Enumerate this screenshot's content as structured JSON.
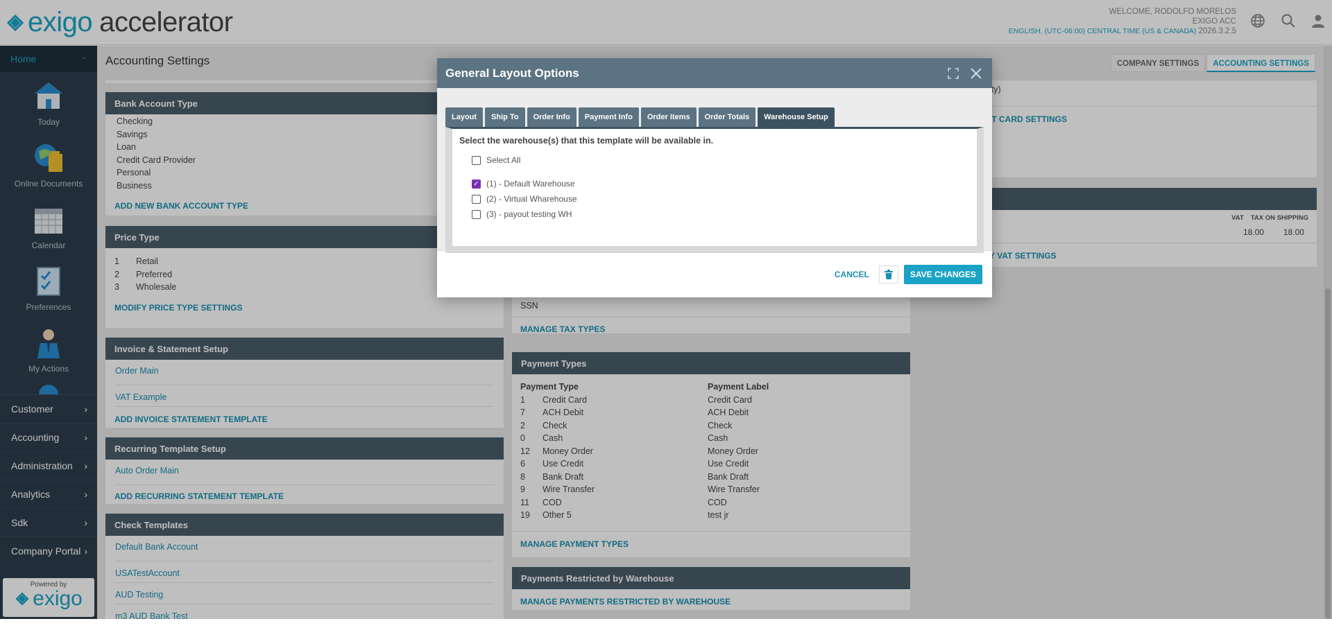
{
  "header": {
    "logo_word1": "exigo",
    "logo_word2": "accelerator",
    "welcome": "WELCOME, RODOLFO MORELOS",
    "company": "EXIGO ACC",
    "timezone": "ENGLISH, (UTC-06:00) CENTRAL TIME (US & CANADA)",
    "version": "2026.3.2.5",
    "icons": [
      "globe-icon",
      "search-icon",
      "user-icon"
    ]
  },
  "sidebar": {
    "home": "Home",
    "tiles": [
      {
        "label": "Today",
        "icon": "house-icon"
      },
      {
        "label": "Online Documents",
        "icon": "globe-folder-icon"
      },
      {
        "label": "Calendar",
        "icon": "calendar-icon"
      },
      {
        "label": "Preferences",
        "icon": "checklist-icon"
      },
      {
        "label": "My Actions",
        "icon": "person-icon"
      }
    ],
    "nav": [
      "Customer",
      "Accounting",
      "Administration",
      "Analytics",
      "Sdk",
      "Company Portal"
    ],
    "powered_by": "Powered by",
    "powered_logo": "exigo"
  },
  "page": {
    "title": "Accounting Settings",
    "tabs": [
      "COMPANY SETTINGS",
      "ACCOUNTING SETTINGS"
    ]
  },
  "bank_account_type": {
    "title": "Bank Account Type",
    "items": [
      "Checking",
      "Savings",
      "Loan",
      "Credit Card Provider",
      "Personal",
      "Business"
    ],
    "action": "ADD NEW BANK ACCOUNT TYPE"
  },
  "price_type": {
    "title": "Price Type",
    "items": [
      {
        "id": "1",
        "name": "Retail"
      },
      {
        "id": "2",
        "name": "Preferred"
      },
      {
        "id": "3",
        "name": "Wholesale"
      }
    ],
    "action": "MODIFY PRICE TYPE SETTINGS"
  },
  "invoice_setup": {
    "title": "Invoice & Statement Setup",
    "items": [
      "Order Main",
      "VAT Example"
    ],
    "action": "ADD INVOICE STATEMENT TEMPLATE"
  },
  "recurring_setup": {
    "title": "Recurring Template Setup",
    "items": [
      "Auto Order Main"
    ],
    "action": "ADD RECURRING STATEMENT TEMPLATE"
  },
  "check_templates": {
    "title": "Check Templates",
    "items": [
      "Default Bank Account",
      "USATestAccount",
      "AUD Testing",
      "m3 AUD Bank Test"
    ]
  },
  "tax_types": {
    "last_item": "SSN",
    "action": "MANAGE TAX TYPES"
  },
  "payment_types": {
    "title": "Payment Types",
    "col_type": "Payment Type",
    "col_label": "Payment Label",
    "rows": [
      {
        "id": "1",
        "type": "Credit Card",
        "label": "Credit Card"
      },
      {
        "id": "7",
        "type": "ACH Debit",
        "label": "ACH Debit"
      },
      {
        "id": "2",
        "type": "Check",
        "label": "Check"
      },
      {
        "id": "0",
        "type": "Cash",
        "label": "Cash"
      },
      {
        "id": "12",
        "type": "Money Order",
        "label": "Money Order"
      },
      {
        "id": "6",
        "type": "Use Credit",
        "label": "Use Credit"
      },
      {
        "id": "8",
        "type": "Bank Draft",
        "label": "Bank Draft"
      },
      {
        "id": "9",
        "type": "Wire Transfer",
        "label": "Wire Transfer"
      },
      {
        "id": "11",
        "type": "COD",
        "label": "COD"
      },
      {
        "id": "19",
        "type": "Other 5",
        "label": "test jr"
      }
    ],
    "action": "MANAGE PAYMENT TYPES"
  },
  "payments_restricted": {
    "title": "Payments Restricted by Warehouse",
    "action": "MANAGE PAYMENTS RESTRICTED BY WAREHOUSE"
  },
  "right_col": {
    "partial_text": "ity)",
    "card_link": "IT CARD SETTINGS",
    "vat_header": "VAT",
    "tax_ship_header": "TAX ON SHIPPING",
    "vat_value": "18.00",
    "tax_ship_value": "18.00",
    "vat_link": "Y VAT SETTINGS"
  },
  "modal": {
    "title": "General Layout Options",
    "tabs": [
      "Layout",
      "Ship To",
      "Order Info",
      "Payment Info",
      "Order Items",
      "Order Totals",
      "Warehouse Setup"
    ],
    "active_tab": "Warehouse Setup",
    "question": "Select the warehouse(s) that this template will be available in.",
    "select_all": "Select All",
    "warehouses": [
      {
        "label": "(1) - Default Warehouse",
        "checked": true
      },
      {
        "label": "(2) - Virtual Wharehouse",
        "checked": false
      },
      {
        "label": "(3) - payout testing WH",
        "checked": false
      }
    ],
    "cancel": "CANCEL",
    "save": "SAVE CHANGES"
  }
}
